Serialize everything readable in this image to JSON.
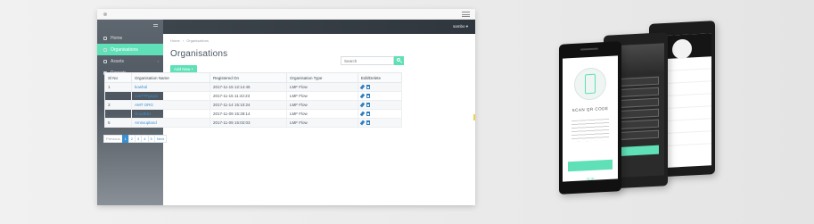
{
  "window": {
    "title": ""
  },
  "sidebar": {
    "items": [
      {
        "label": "Home",
        "active": false
      },
      {
        "label": "Organisations",
        "active": true
      },
      {
        "label": "Assets",
        "active": false
      },
      {
        "label": "Reports",
        "active": false
      }
    ]
  },
  "topbar": {
    "user": "sambo ▾"
  },
  "breadcrumb": {
    "home": "Home",
    "current": "Organisations"
  },
  "page": {
    "title": "Organisations",
    "add_button": "Add New +"
  },
  "search": {
    "placeholder": "Search"
  },
  "table": {
    "headers": [
      "Sl No",
      "Organisation Name",
      "Registered On",
      "Organisation Type",
      "Edit/Delete"
    ],
    "rows": [
      {
        "no": "1",
        "name": "kowhal",
        "registered": "2017-11-15 12:14:45",
        "type": "LMF Flow"
      },
      {
        "no": "2",
        "name": "cosTTFgogio",
        "registered": "2017-11-15 11:42:23",
        "type": "LMF Flow"
      },
      {
        "no": "3",
        "name": "AMT ORG",
        "registered": "2017-11-14 15:10:24",
        "type": "LMF Flow"
      },
      {
        "no": "4",
        "name": "cloudEEI",
        "registered": "2017-11-09 15:28:14",
        "type": "LMF Flow"
      },
      {
        "no": "5",
        "name": "Amsvupland",
        "registered": "2017-11-09 15:02:03",
        "type": "LMF Flow"
      }
    ]
  },
  "pagination": {
    "previous": "Previous",
    "pages": [
      "1",
      "2",
      "3",
      "4",
      "5"
    ],
    "next": "Next",
    "current": "1"
  },
  "colors": {
    "accent": "#5fe0b7",
    "link": "#3a8fd0",
    "sidebar": "#5e6770"
  },
  "phones": {
    "front": {
      "heading": "SCAN QR CODE",
      "skip": "SKIP"
    }
  }
}
